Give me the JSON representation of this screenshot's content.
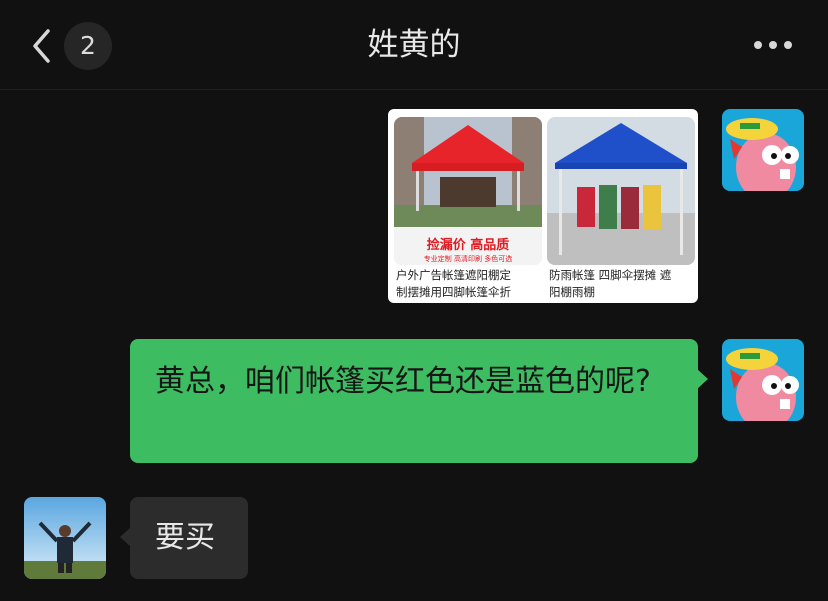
{
  "header": {
    "back_label": "<",
    "unread_count": "2",
    "title": "姓黄的",
    "more_label": "•••"
  },
  "messages": {
    "product_card": {
      "items": [
        {
          "banner_main": "捡漏价 高品质",
          "banner_sub": "专业定制  高清印刷  多色可选",
          "caption_line1": "户外广告帐篷遮阳棚定",
          "caption_line2": "制摆摊用四脚帐篷伞折",
          "canopy_color": "#e8242b"
        },
        {
          "caption_line1": "防雨帐篷 四脚伞摆摊 遮",
          "caption_line2": "阳棚雨棚",
          "canopy_color": "#1f4fc9"
        }
      ]
    },
    "sent_text": "黄总，咱们帐篷买红色还是蓝色的呢?",
    "received_text": "要买"
  },
  "colors": {
    "background": "#111111",
    "sent_bubble": "#3ebc62",
    "received_bubble": "#2c2c2c"
  }
}
